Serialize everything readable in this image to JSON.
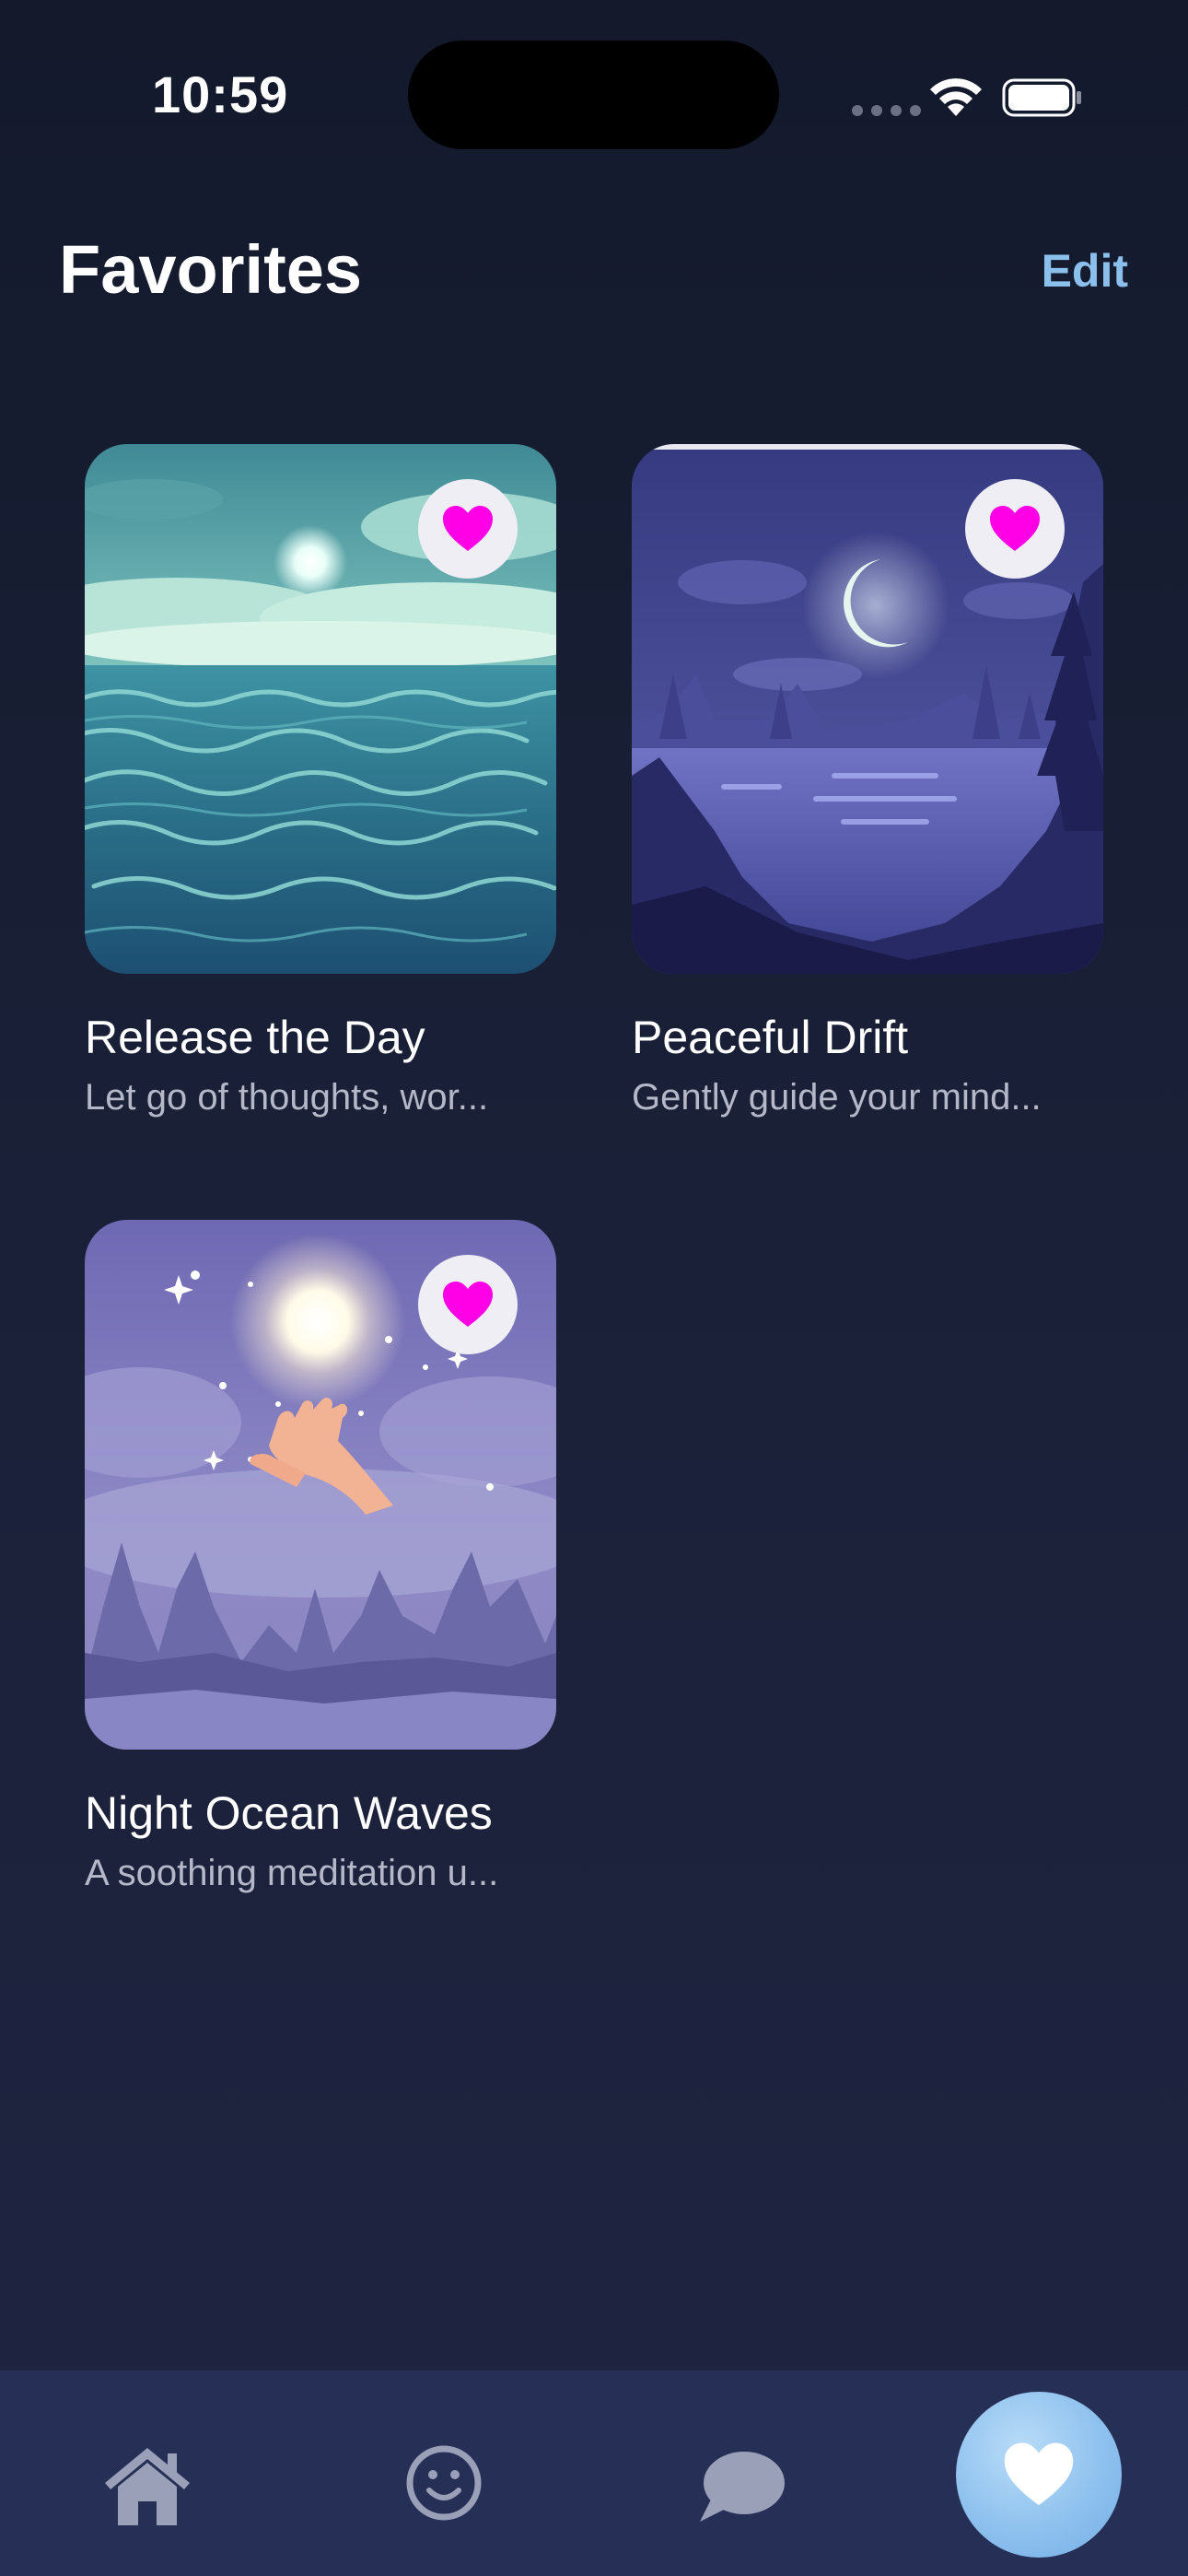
{
  "status_bar": {
    "time": "10:59"
  },
  "header": {
    "title": "Favorites",
    "edit_label": "Edit"
  },
  "favorites": [
    {
      "title": "Release the Day",
      "subtitle": "Let go of thoughts, wor...",
      "artwork": "ocean-waves-artwork",
      "favorited": true
    },
    {
      "title": "Peaceful Drift",
      "subtitle": "Gently guide your mind...",
      "artwork": "moonlit-lake-artwork",
      "favorited": true
    },
    {
      "title": "Night Ocean Waves",
      "subtitle": "A soothing meditation u...",
      "artwork": "glowing-hand-artwork",
      "favorited": true
    }
  ],
  "tab_bar": {
    "tabs": [
      {
        "icon": "home-icon",
        "active": false
      },
      {
        "icon": "smiley-icon",
        "active": false
      },
      {
        "icon": "chat-bubble-icon",
        "active": false
      },
      {
        "icon": "heart-icon",
        "active": true
      }
    ]
  },
  "colors": {
    "accent": "#8cc0ec",
    "heart": "#ff00e6",
    "background": "#1b2139",
    "tab_bar": "#262f55"
  }
}
